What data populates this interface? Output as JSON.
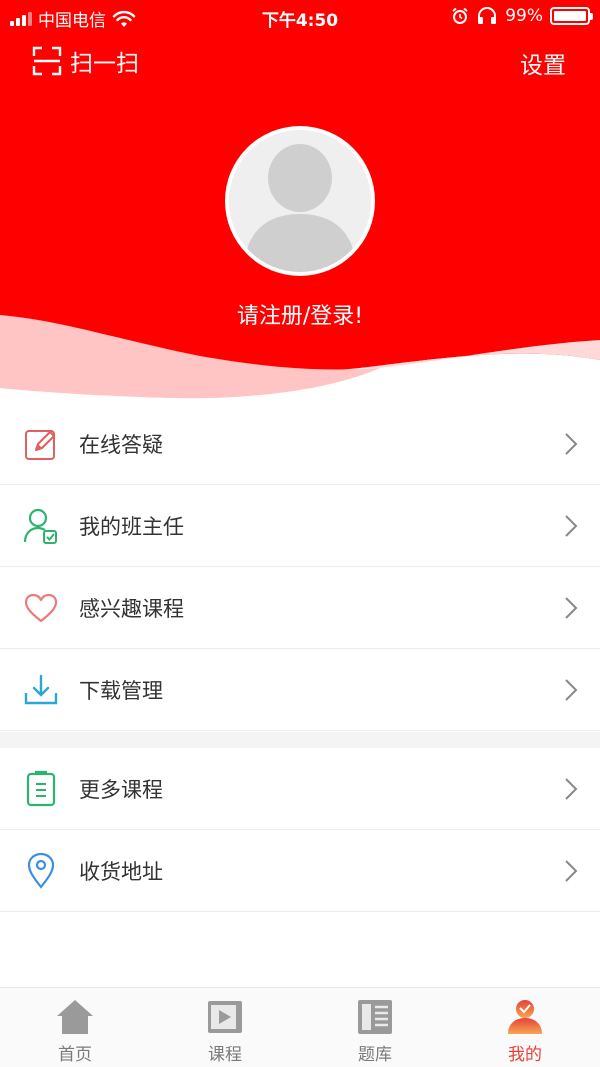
{
  "status_bar": {
    "carrier": "中国电信",
    "time": "下午4:50",
    "battery": "99%",
    "battery_level": 0.99
  },
  "header": {
    "scan_label": "扫一扫",
    "settings_label": "设置",
    "login_prompt": "请注册/登录!"
  },
  "menu": {
    "group1": [
      {
        "label": "在线答疑",
        "icon": "edit-icon"
      },
      {
        "label": "我的班主任",
        "icon": "head-teacher-icon"
      },
      {
        "label": "感兴趣课程",
        "icon": "heart-icon"
      },
      {
        "label": "下载管理",
        "icon": "download-icon"
      }
    ],
    "group2": [
      {
        "label": "更多课程",
        "icon": "clipboard-icon"
      },
      {
        "label": "收货地址",
        "icon": "location-pin-icon"
      }
    ]
  },
  "tabbar": {
    "tabs": [
      {
        "label": "首页",
        "icon": "home-icon",
        "active": false
      },
      {
        "label": "课程",
        "icon": "video-icon",
        "active": false
      },
      {
        "label": "题库",
        "icon": "question-bank-icon",
        "active": false
      },
      {
        "label": "我的",
        "icon": "profile-icon",
        "active": true
      }
    ]
  },
  "colors": {
    "brand_red": "#ff0000",
    "wave_light": "#ffc4c4",
    "active_tab": "#e8423a",
    "inactive_tab": "#7a7a7a"
  }
}
